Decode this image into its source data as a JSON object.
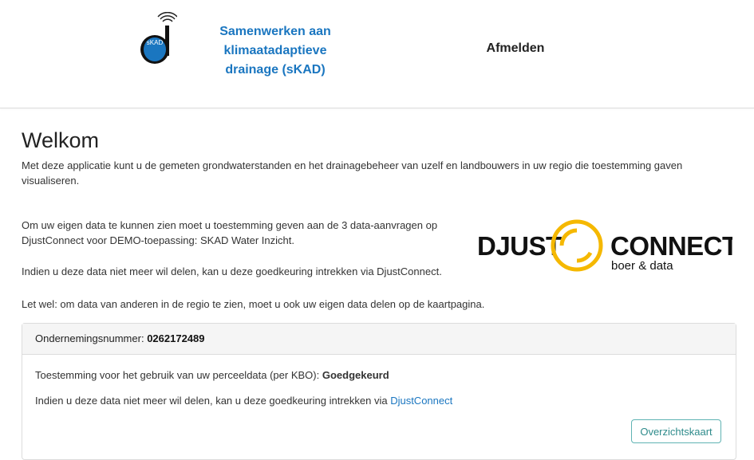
{
  "header": {
    "logo_text": "sKAD",
    "app_title_line1": "Samenwerken aan",
    "app_title_line2": "klimaatadaptieve",
    "app_title_line3": "drainage (sKAD)",
    "logout_label": "Afmelden"
  },
  "main": {
    "title": "Welkom",
    "intro": "Met deze applicatie kunt u de gemeten grondwaterstanden en het drainagebeheer van uzelf en landbouwers in uw regio die toestemming gaven visualiseren.",
    "consent_text": "Om uw eigen data te kunnen zien moet u toestemming geven aan de 3 data-aanvragen op DjustConnect voor DEMO-toepassing: SKAD Water Inzicht.",
    "revoke_text": "Indien u deze data niet meer wil delen, kan u deze goedkeuring intrekken via DjustConnect.",
    "share_note": "Let wel: om data van anderen in de regio te zien, moet u ook uw eigen data delen op de kaartpagina."
  },
  "djust_logo": {
    "word1": "DJUST",
    "word2": "CONNECT",
    "tagline": "boer & data"
  },
  "card": {
    "company_label": "Ondernemingsnummer:",
    "company_number": "0262172489",
    "permission_label": "Toestemming voor het gebruik van uw perceeldata (per KBO):",
    "permission_status": "Goedgekeurd",
    "revoke_prefix": "Indien u deze data niet meer wil delen, kan u deze goedkeuring intrekken via ",
    "revoke_link": "DjustConnect",
    "overview_button": "Overzichtskaart"
  },
  "colors": {
    "accent": "#1a76c0",
    "logo_ring": "#f5b800",
    "button_border": "#5fb3b3"
  }
}
